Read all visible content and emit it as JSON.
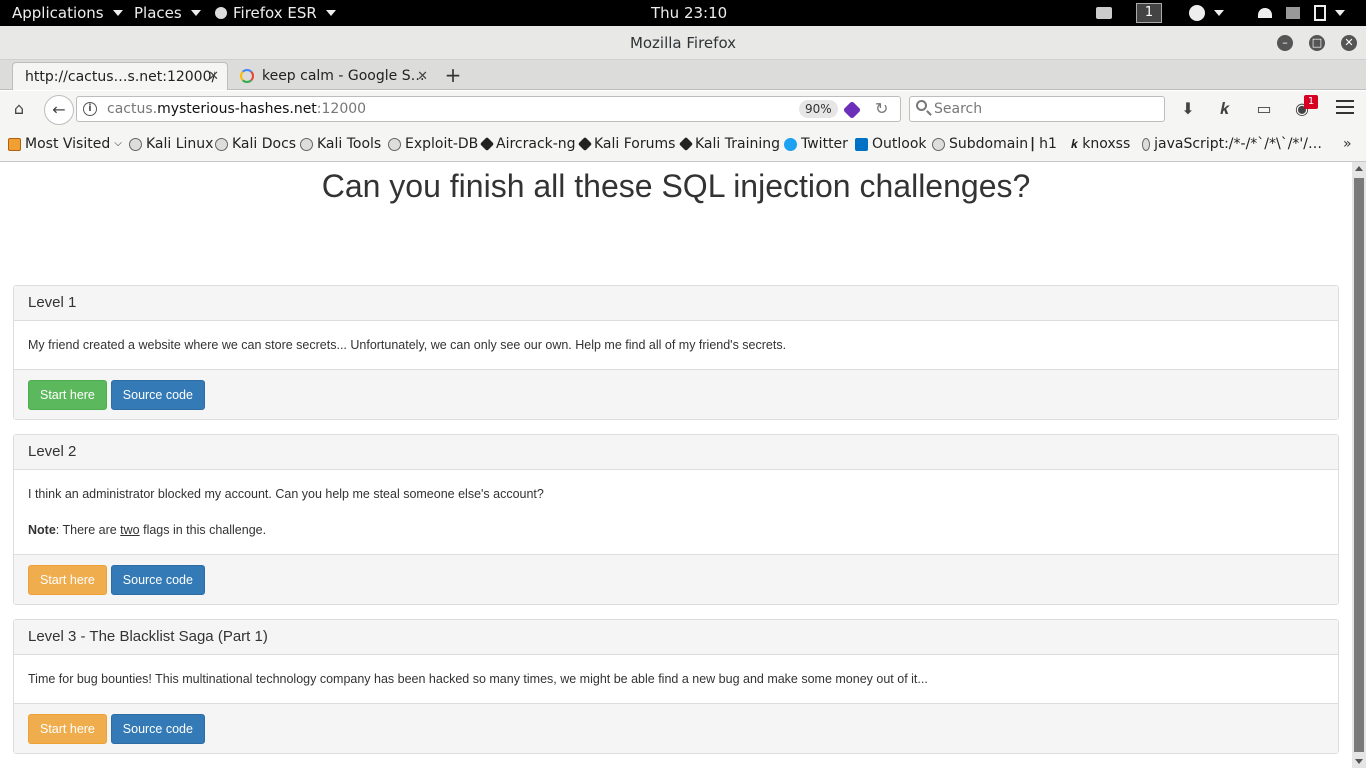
{
  "system_bar": {
    "applications": "Applications",
    "places": "Places",
    "firefox": "Firefox ESR",
    "clock": "Thu 23:10",
    "workspace": "1"
  },
  "window": {
    "title": "Mozilla Firefox"
  },
  "tabs": [
    {
      "title": "http://cactus…s.net:12000/",
      "active": true
    },
    {
      "title": "keep calm - Google S…",
      "active": false
    }
  ],
  "navbar": {
    "url_prefix": "cactus.",
    "url_host": "mysterious-hashes.net",
    "url_port": ":12000",
    "zoom": "90%",
    "search_placeholder": "Search",
    "notification_count": "1"
  },
  "bookmarks": [
    {
      "label": "Most Visited",
      "icon": "folder-icon"
    },
    {
      "label": "Kali Linux",
      "icon": "globe-icon"
    },
    {
      "label": "Kali Docs",
      "icon": "globe-icon"
    },
    {
      "label": "Kali Tools",
      "icon": "globe-icon"
    },
    {
      "label": "Exploit-DB",
      "icon": "exploit-db-icon"
    },
    {
      "label": "Aircrack-ng",
      "icon": "aircrack-icon"
    },
    {
      "label": "Kali Forums",
      "icon": "kali-dragon-icon"
    },
    {
      "label": "Kali Training",
      "icon": "kali-dragon-icon"
    },
    {
      "label": "Twitter",
      "icon": "twitter-icon"
    },
    {
      "label": "Outlook",
      "icon": "outlook-icon"
    },
    {
      "label": "Subdomain",
      "icon": "globe-icon"
    },
    {
      "label": "h1",
      "icon": "hackerone-icon"
    },
    {
      "label": "knoxss",
      "icon": "knoxss-icon"
    },
    {
      "label": "javaScript:/*-/*`/*\\`/*'/…",
      "icon": "globe-icon"
    }
  ],
  "page": {
    "heading": "Can you finish all these SQL injection challenges?",
    "levels": [
      {
        "title": "Level 1",
        "description": "My friend created a website where we can store secrets... Unfortunately, we can only see our own. Help me find all of my friend's secrets.",
        "start_label": "Start here",
        "source_label": "Source code"
      },
      {
        "title": "Level 2",
        "description": "I think an administrator blocked my account. Can you help me steal someone else's account?",
        "note_label": "Note",
        "note_pre": ": There are ",
        "note_em": "two",
        "note_post": " flags in this challenge.",
        "start_label": "Start here",
        "source_label": "Source code"
      },
      {
        "title": "Level 3 - The Blacklist Saga (Part 1)",
        "description": "Time for bug bounties! This multinational technology company has been hacked so many times, we might be able find a new bug and make some money out of it...",
        "start_label": "Start here",
        "source_label": "Source code"
      }
    ]
  }
}
